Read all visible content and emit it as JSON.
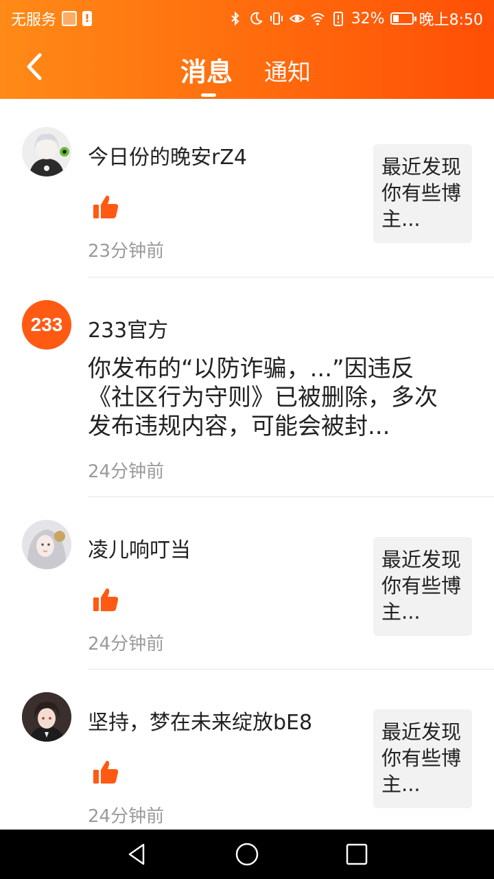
{
  "status_bar": {
    "carrier": "无服务",
    "battery_percent": "32%",
    "time": "晚上8:50",
    "battery_level": 0.32,
    "icons": [
      "box-icon",
      "warning-icon",
      "bluetooth-icon",
      "moon-icon",
      "vibrate-icon",
      "eye-icon",
      "wifi-icon",
      "battery-alert-icon",
      "battery-icon"
    ]
  },
  "header": {
    "back_icon": "back-arrow-icon",
    "tabs": [
      {
        "label": "消息",
        "active": true
      },
      {
        "label": "通知",
        "active": false
      }
    ],
    "gradient": [
      "#ff8a17",
      "#ff4f06"
    ]
  },
  "messages": [
    {
      "name": "今日份的晚安rZ4",
      "action_icon": "thumbs-up-icon",
      "time": "23分钟前",
      "preview": "最近发现你有些博主..."
    },
    {
      "name": "233官方",
      "avatar_text": "233",
      "body": "你发布的“以防诈骗，...”因违反《社区行为守则》已被删除，多次发布违规内容，可能会被封...",
      "time": "24分钟前"
    },
    {
      "name": "凌儿响叮当",
      "action_icon": "thumbs-up-icon",
      "time": "24分钟前",
      "preview": "最近发现你有些博主..."
    },
    {
      "name": "坚持，梦在未来绽放bE8",
      "action_icon": "thumbs-up-icon",
      "time": "24分钟前",
      "preview": "最近发现你有些博主..."
    }
  ],
  "colors": {
    "accent": "#ff6a0d",
    "like": "#ff5a14",
    "time": "#9a9a9a",
    "preview_bg": "#f2f2f2"
  },
  "nav_bar": {
    "buttons": [
      "back-triangle-icon",
      "home-circle-icon",
      "recents-square-icon"
    ]
  }
}
